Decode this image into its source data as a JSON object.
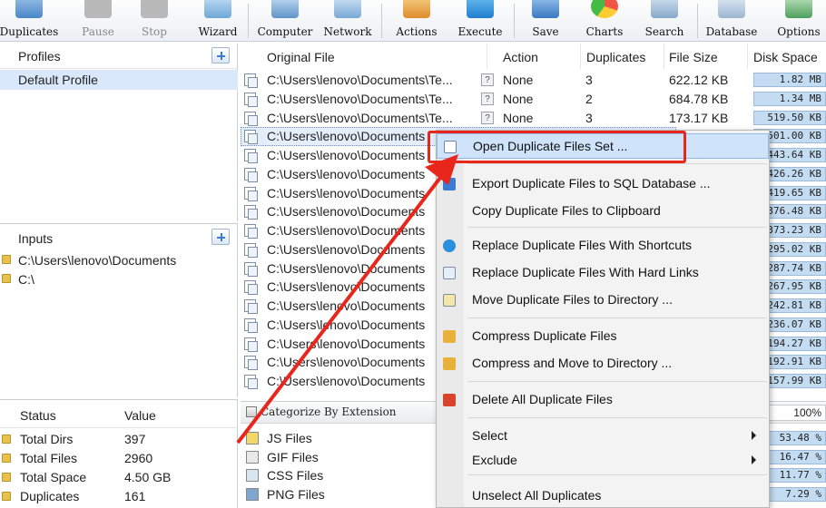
{
  "toolbar": {
    "buttons": [
      {
        "label": "Duplicates",
        "icon": "duplicates-icon"
      },
      {
        "label": "Pause",
        "icon": "pause-icon"
      },
      {
        "label": "Stop",
        "icon": "stop-icon"
      },
      {
        "label": "Wizard",
        "icon": "wizard-icon"
      },
      {
        "label": "Computer",
        "icon": "computer-icon"
      },
      {
        "label": "Network",
        "icon": "network-icon"
      },
      {
        "label": "Actions",
        "icon": "actions-icon"
      },
      {
        "label": "Execute",
        "icon": "execute-icon"
      },
      {
        "label": "Save",
        "icon": "save-icon"
      },
      {
        "label": "Charts",
        "icon": "charts-icon"
      },
      {
        "label": "Search",
        "icon": "search-icon"
      },
      {
        "label": "Database",
        "icon": "database-icon"
      },
      {
        "label": "Options",
        "icon": "options-icon"
      }
    ]
  },
  "profiles": {
    "title": "Profiles",
    "items": [
      "Default Profile"
    ]
  },
  "inputs": {
    "title": "Inputs",
    "items": [
      "C:\\Users\\lenovo\\Documents",
      "C:\\"
    ]
  },
  "status": {
    "headers": [
      "Status",
      "Value"
    ],
    "rows": [
      [
        "Total Dirs",
        "397"
      ],
      [
        "Total Files",
        "2960"
      ],
      [
        "Total Space",
        "4.50 GB"
      ],
      [
        "Duplicates",
        "161"
      ]
    ]
  },
  "file_list": {
    "headers": [
      "Original File",
      "Action",
      "Duplicates",
      "File Size",
      "Disk Space"
    ],
    "rows": [
      {
        "path": "C:\\Users\\lenovo\\Documents\\Te...",
        "action": "None",
        "dup": "3",
        "size": "622.12 KB",
        "disk": "1.82 MB"
      },
      {
        "path": "C:\\Users\\lenovo\\Documents\\Te...",
        "action": "None",
        "dup": "2",
        "size": "684.78 KB",
        "disk": "1.34 MB"
      },
      {
        "path": "C:\\Users\\lenovo\\Documents\\Te...",
        "action": "None",
        "dup": "3",
        "size": "173.17 KB",
        "disk": "519.50 KB"
      },
      {
        "path": "C:\\Users\\lenovo\\Documents",
        "action": "",
        "dup": "",
        "size": "",
        "disk": "501.00 KB"
      },
      {
        "path": "C:\\Users\\lenovo\\Documents",
        "action": "",
        "dup": "",
        "size": "",
        "disk": "443.64 KB"
      },
      {
        "path": "C:\\Users\\lenovo\\Documents",
        "action": "",
        "dup": "",
        "size": "",
        "disk": "426.26 KB"
      },
      {
        "path": "C:\\Users\\lenovo\\Documents",
        "action": "",
        "dup": "",
        "size": "",
        "disk": "419.65 KB"
      },
      {
        "path": "C:\\Users\\lenovo\\Documents",
        "action": "",
        "dup": "",
        "size": "",
        "disk": "376.48 KB"
      },
      {
        "path": "C:\\Users\\lenovo\\Documents",
        "action": "",
        "dup": "",
        "size": "",
        "disk": "373.23 KB"
      },
      {
        "path": "C:\\Users\\lenovo\\Documents",
        "action": "",
        "dup": "",
        "size": "",
        "disk": "295.02 KB"
      },
      {
        "path": "C:\\Users\\lenovo\\Documents",
        "action": "",
        "dup": "",
        "size": "",
        "disk": "287.74 KB"
      },
      {
        "path": "C:\\Users\\lenovo\\Documents",
        "action": "",
        "dup": "",
        "size": "",
        "disk": "267.95 KB"
      },
      {
        "path": "C:\\Users\\lenovo\\Documents",
        "action": "",
        "dup": "",
        "size": "",
        "disk": "242.81 KB"
      },
      {
        "path": "C:\\Users\\lenovo\\Documents",
        "action": "",
        "dup": "",
        "size": "",
        "disk": "236.07 KB"
      },
      {
        "path": "C:\\Users\\lenovo\\Documents",
        "action": "",
        "dup": "",
        "size": "",
        "disk": "194.27 KB"
      },
      {
        "path": "C:\\Users\\lenovo\\Documents",
        "action": "",
        "dup": "",
        "size": "",
        "disk": "192.91 KB"
      },
      {
        "path": "C:\\Users\\lenovo\\Documents",
        "action": "",
        "dup": "",
        "size": "",
        "disk": "157.99 KB"
      }
    ]
  },
  "categories": {
    "title": "Categorize By Extension",
    "total_pct": "100%",
    "rows": [
      {
        "name": "JS Files",
        "pct": "53.48 %"
      },
      {
        "name": "GIF Files",
        "pct": "16.47 %"
      },
      {
        "name": "CSS Files",
        "pct": "11.77 %"
      },
      {
        "name": "PNG Files",
        "pct": "7.29 %"
      }
    ]
  },
  "context_menu": {
    "items": [
      {
        "label": "Open Duplicate Files Set ...",
        "icon": "open-set-icon"
      },
      {
        "label": "Export Duplicate Files to SQL Database ...",
        "icon": "export-sql-icon"
      },
      {
        "label": "Copy Duplicate Files to Clipboard",
        "icon": ""
      },
      {
        "label": "Replace Duplicate Files With Shortcuts",
        "icon": "shortcut-icon"
      },
      {
        "label": "Replace Duplicate Files With Hard Links",
        "icon": "hardlink-icon"
      },
      {
        "label": "Move Duplicate Files to Directory ...",
        "icon": "move-icon"
      },
      {
        "label": "Compress Duplicate Files",
        "icon": "compress-icon"
      },
      {
        "label": "Compress and Move to Directory ...",
        "icon": "compress-move-icon"
      },
      {
        "label": "Delete All Duplicate Files",
        "icon": "delete-icon"
      },
      {
        "label": "Select",
        "icon": ""
      },
      {
        "label": "Exclude",
        "icon": ""
      },
      {
        "label": "Unselect All Duplicates",
        "icon": ""
      }
    ]
  },
  "colors": {
    "highlight": "#e8261c",
    "selection": "#cfe3fb",
    "bar": "#c4dcf2"
  }
}
